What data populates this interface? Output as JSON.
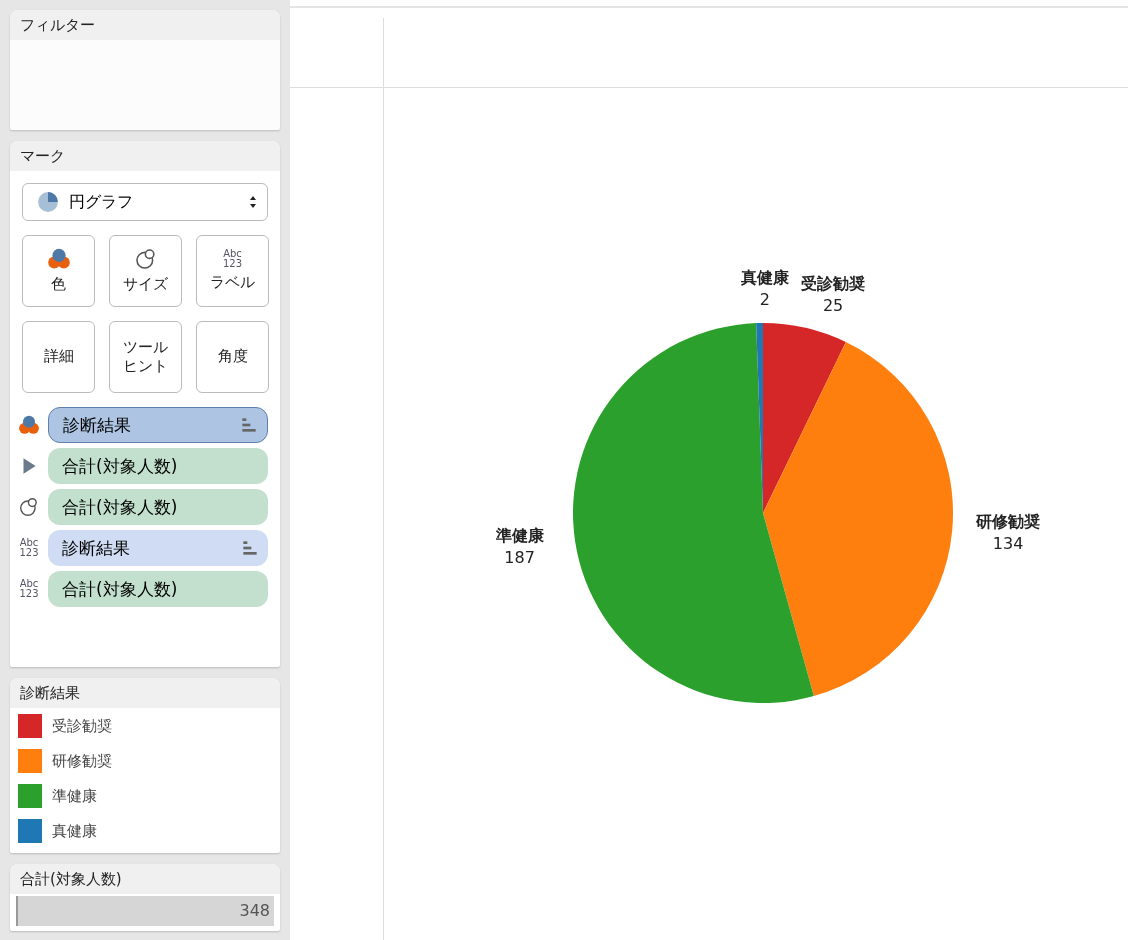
{
  "filters": {
    "title": "フィルター"
  },
  "marks": {
    "title": "マーク",
    "mark_type": "円グラフ",
    "buttons": [
      {
        "kind": "color",
        "label": "色"
      },
      {
        "kind": "size",
        "label": "サイズ"
      },
      {
        "kind": "label",
        "label": "ラベル",
        "icon_text": "Abc\n123"
      },
      {
        "kind": "plain",
        "label": "詳細"
      },
      {
        "kind": "plain",
        "label": "ツールヒント"
      },
      {
        "kind": "plain",
        "label": "角度"
      }
    ],
    "pills": [
      {
        "kind": "color",
        "text": "診断結果",
        "color": "#adc4e3",
        "selected": true,
        "sorted": true
      },
      {
        "kind": "angle",
        "text": "合計(対象人数)",
        "color": "#c2e0cd",
        "selected": false,
        "sorted": false
      },
      {
        "kind": "size",
        "text": "合計(対象人数)",
        "color": "#c2e0cd",
        "selected": false,
        "sorted": false
      },
      {
        "kind": "label",
        "icon_text": "Abc\n123",
        "text": "診断結果",
        "color": "#cfdcf3",
        "selected": false,
        "sorted": true
      },
      {
        "kind": "label",
        "icon_text": "Abc\n123",
        "text": "合計(対象人数)",
        "color": "#c2e0cd",
        "selected": false,
        "sorted": false
      }
    ]
  },
  "color_legend": {
    "title": "診断結果",
    "items": [
      {
        "label": "受診勧奨",
        "color": "#d62728"
      },
      {
        "label": "研修勧奨",
        "color": "#ff7f0e"
      },
      {
        "label": "準健康",
        "color": "#2ca02c"
      },
      {
        "label": "真健康",
        "color": "#1f77b4"
      }
    ]
  },
  "size_legend": {
    "title": "合計(対象人数)",
    "value": "348",
    "level": 1
  },
  "chart": {
    "chart_data": {
      "type": "pie",
      "categories": [
        "受診勧奨",
        "研修勧奨",
        "準健康",
        "真健康"
      ],
      "values": [
        25,
        134,
        187,
        2
      ],
      "data_labels": true
    }
  }
}
